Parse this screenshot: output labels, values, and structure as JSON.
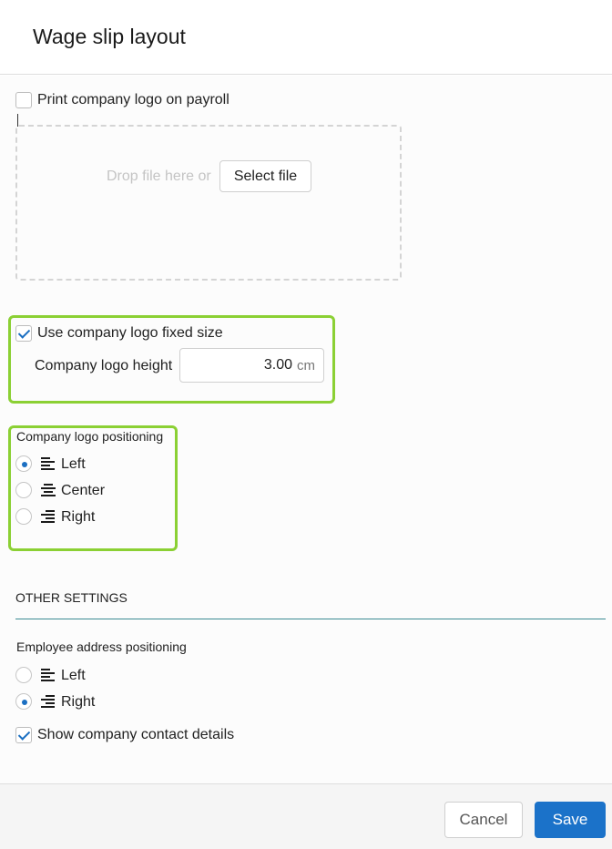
{
  "dialog": {
    "title": "Wage slip layout"
  },
  "logo": {
    "print_logo_label": "Print company logo on payroll",
    "print_logo_checked": false,
    "dropzone_text": "Drop file here or",
    "select_file_label": "Select file",
    "fixed_size_label": "Use company logo fixed size",
    "fixed_size_checked": true,
    "height_label": "Company logo height",
    "height_value": "3.00",
    "height_unit": "cm"
  },
  "logo_positioning": {
    "label": "Company logo positioning",
    "options": [
      {
        "label": "Left",
        "selected": true,
        "icon": "align-left-icon"
      },
      {
        "label": "Center",
        "selected": false,
        "icon": "align-center-icon"
      },
      {
        "label": "Right",
        "selected": false,
        "icon": "align-right-icon"
      }
    ]
  },
  "other_settings": {
    "title": "OTHER SETTINGS",
    "address_label": "Employee address positioning",
    "address_options": [
      {
        "label": "Left",
        "selected": false,
        "icon": "align-left-icon"
      },
      {
        "label": "Right",
        "selected": true,
        "icon": "align-right-icon"
      }
    ],
    "contact_details_label": "Show company contact details",
    "contact_details_checked": true
  },
  "footer": {
    "cancel_label": "Cancel",
    "save_label": "Save"
  },
  "colors": {
    "accent": "#1b72c9",
    "highlight": "#8bd034",
    "section_line": "#3b8b93"
  }
}
